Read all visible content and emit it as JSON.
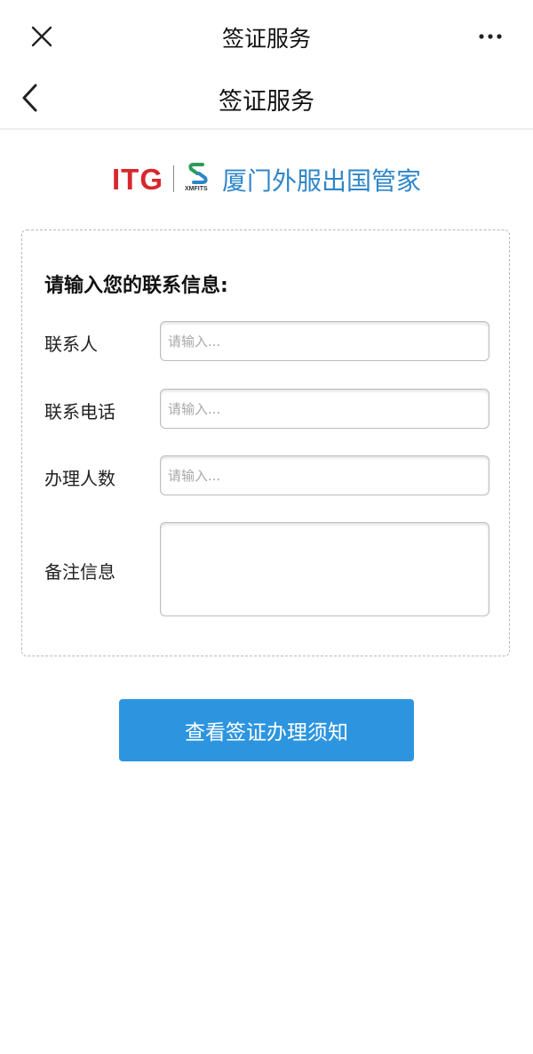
{
  "window": {
    "title": "签证服务",
    "close_icon": "close-icon",
    "more_icon": "more-icon"
  },
  "navbar": {
    "title": "签证服务",
    "back_icon": "chevron-left-icon"
  },
  "brand": {
    "itg_logo": "ITG",
    "xmfits_logo": "XMFITS",
    "name": "厦门外服出国管家",
    "colors": {
      "itg_red": "#d8272d",
      "brand_blue": "#2e86c8",
      "logo_green": "#2a9d5c"
    }
  },
  "form": {
    "heading": "请输入您的联系信息:",
    "fields": [
      {
        "label": "联系人",
        "placeholder": "请输入...",
        "value": ""
      },
      {
        "label": "联系电话",
        "placeholder": "请输入...",
        "value": ""
      },
      {
        "label": "办理人数",
        "placeholder": "请输入...",
        "value": ""
      },
      {
        "label": "备注信息",
        "placeholder": "",
        "value": ""
      }
    ]
  },
  "actions": {
    "submit_label": "查看签证办理须知",
    "submit_color": "#2d95e0"
  }
}
